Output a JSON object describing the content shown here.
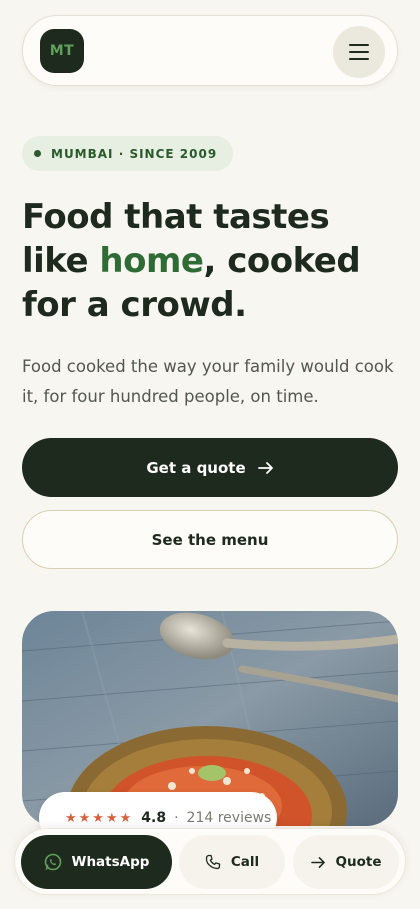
{
  "header": {
    "logo_text": "MT"
  },
  "hero": {
    "badge": "MUMBAI · SINCE 2009",
    "headline_line1": "Food that tastes",
    "headline_like": "like ",
    "headline_accent": "home",
    "headline_rest": ", cooked",
    "headline_line3": "for a crowd.",
    "lead": "Food cooked the way your family would cook it, for four hundred people, on time.",
    "primary_cta": "Get a quote",
    "secondary_cta": "See the menu"
  },
  "rating": {
    "stars": "★★★★★",
    "score": "4.8",
    "separator": "·",
    "reviews": "214 reviews"
  },
  "bottom_bar": {
    "whatsapp": "WhatsApp",
    "call": "Call",
    "quote": "Quote"
  },
  "colors": {
    "brand_dark": "#1e2a1d",
    "accent_green": "#2e6b35",
    "star": "#d5643e",
    "background": "#f8f6f1"
  },
  "icons": [
    "hamburger-menu-icon",
    "arrow-right-icon",
    "whatsapp-icon",
    "phone-icon",
    "star-icon"
  ]
}
